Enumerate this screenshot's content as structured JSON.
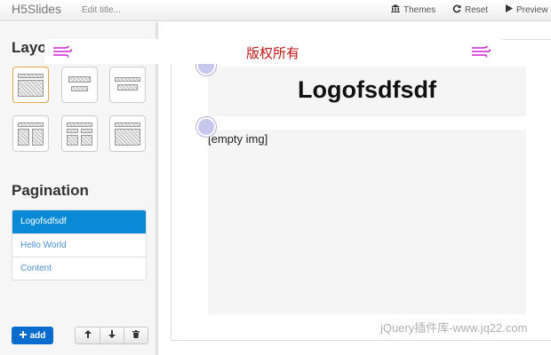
{
  "navbar": {
    "brand": "H5Slides",
    "edit_title": "Edit title...",
    "themes_label": "Themes",
    "reset_label": "Reset",
    "preview_label": "Preview"
  },
  "sidebar": {
    "layout_title": "Layout",
    "pagination_title": "Pagination",
    "pages": [
      {
        "label": "Logofsdfsdf",
        "active": true
      },
      {
        "label": "Hello World",
        "active": false
      },
      {
        "label": "Content",
        "active": false
      }
    ],
    "add_label": "add"
  },
  "slide": {
    "title": "Logofsdfsdf",
    "image_placeholder": "[empty img]"
  },
  "watermark": {
    "text": "版权所有",
    "site": "jQuery插件库-www.jq22.com"
  },
  "colors": {
    "primary": "#0a6ccc",
    "active_page": "#0a8ad6",
    "layout_selected_border": "#e0a450",
    "watermark_text": "#c01818"
  }
}
